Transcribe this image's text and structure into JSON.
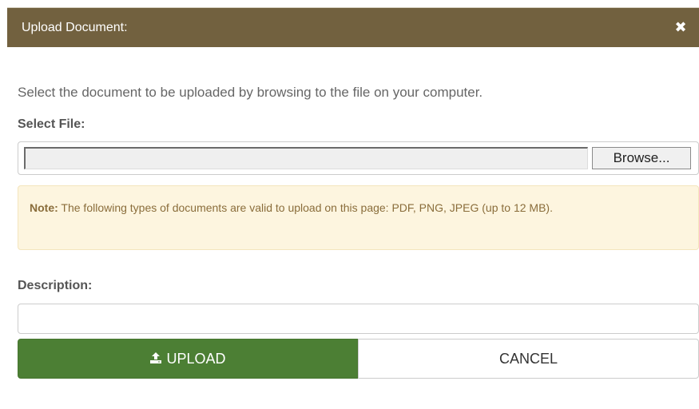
{
  "dialog": {
    "title": "Upload Document:",
    "close_icon": "close-icon",
    "header_color": "#72613f"
  },
  "instruction": "Select the document to be uploaded by browsing to the file on your computer.",
  "select_file": {
    "label": "Select File:",
    "value": "",
    "browse_label": "Browse..."
  },
  "note": {
    "strong": "Note:",
    "text": " The following types of documents are valid to upload on this page: PDF, PNG, JPEG (up to 12 MB).",
    "background": "#fdf5df",
    "text_color": "#8a6d3b"
  },
  "description": {
    "label": "Description:",
    "value": "",
    "placeholder": ""
  },
  "actions": {
    "upload_label": "UPLOAD",
    "upload_icon": "upload-icon",
    "upload_color": "#4c7f34",
    "cancel_label": "CANCEL"
  }
}
